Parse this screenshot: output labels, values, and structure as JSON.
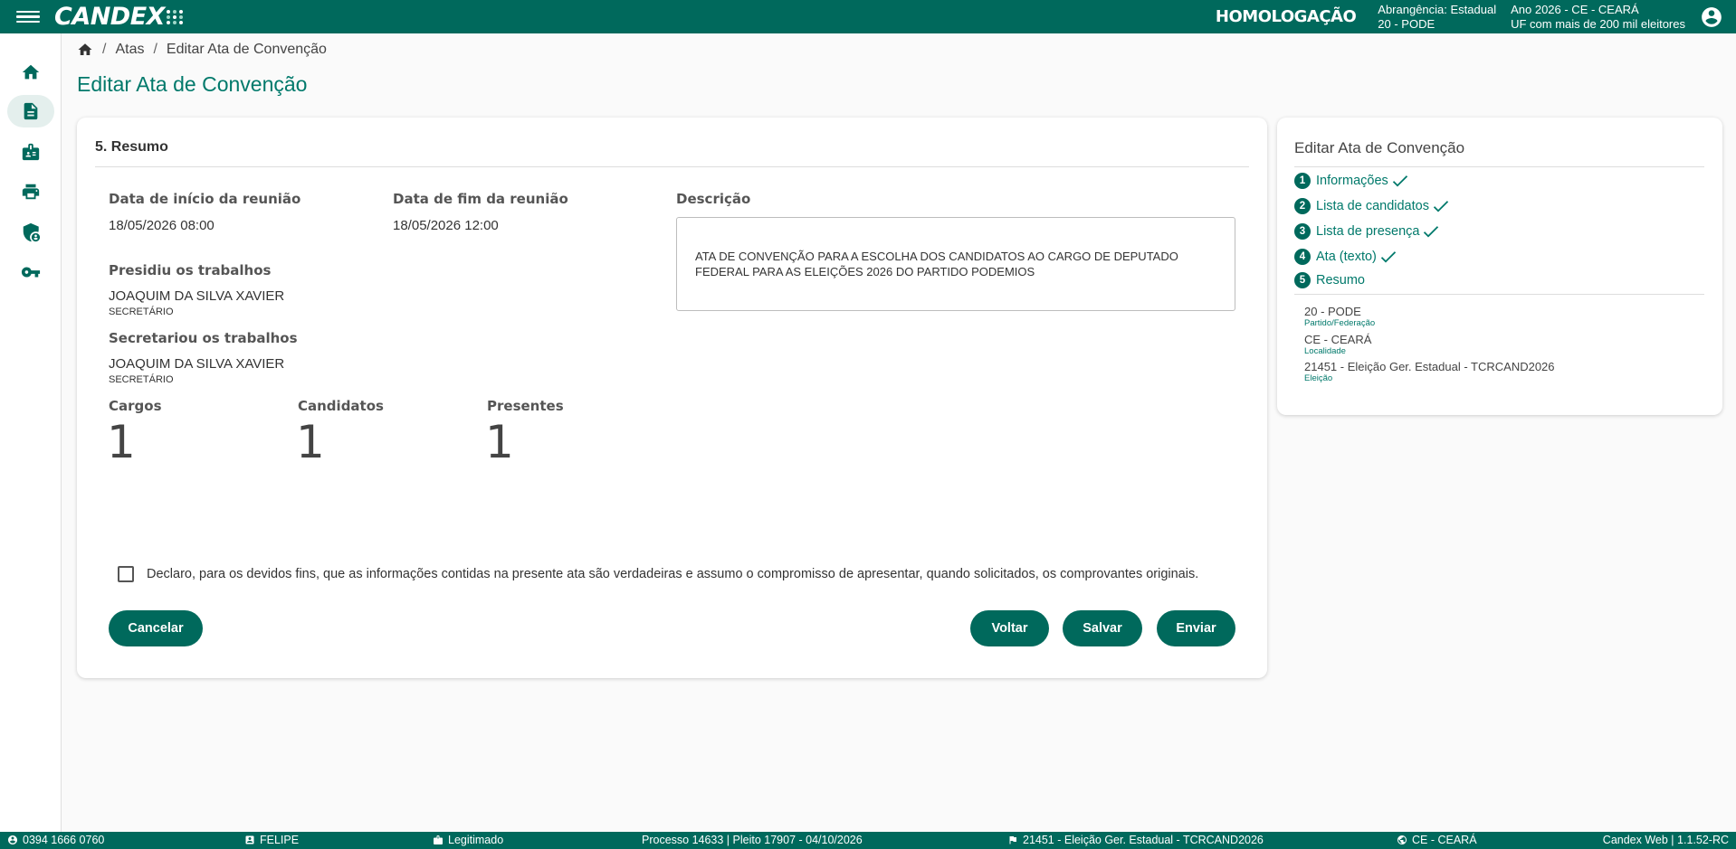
{
  "app": {
    "logo_text": "CANDEX",
    "environment": "HOMOLOGAÇÃO",
    "context": {
      "abrangencia": "Abrangência: Estadual",
      "partido": "20 - PODE",
      "ano": "Ano 2026 - CE - CEARÁ",
      "uf_info": "UF com mais de 200 mil eleitores"
    }
  },
  "nav": {
    "items": [
      {
        "name": "home",
        "icon": "home-icon"
      },
      {
        "name": "atas",
        "icon": "document-icon",
        "active": true
      },
      {
        "name": "candidatos",
        "icon": "badge-icon"
      },
      {
        "name": "imprimir",
        "icon": "print-icon"
      },
      {
        "name": "seguranca",
        "icon": "security-user-icon"
      },
      {
        "name": "chave",
        "icon": "key-icon"
      }
    ]
  },
  "breadcrumb": {
    "home_icon": "home-icon",
    "atas": "Atas",
    "current": "Editar Ata de Convenção"
  },
  "page": {
    "title": "Editar Ata de Convenção"
  },
  "resumo": {
    "section_title": "5. Resumo",
    "data_inicio_label": "Data de início da reunião",
    "data_inicio_value": "18/05/2026 08:00",
    "data_fim_label": "Data de fim da reunião",
    "data_fim_value": "18/05/2026 12:00",
    "descricao_label": "Descrição",
    "descricao_value": "ATA DE CONVENÇÃO PARA A ESCOLHA DOS CANDIDATOS AO CARGO DE DEPUTADO FEDERAL PARA AS ELEIÇÕES 2026 DO PARTIDO PODEMIOS",
    "presidiu_label": "Presidiu os trabalhos",
    "presidiu_nome": "JOAQUIM DA SILVA XAVIER",
    "presidiu_cargo": "SECRETÁRIO",
    "secretariou_label": "Secretariou os trabalhos",
    "secretariou_nome": "JOAQUIM DA SILVA XAVIER",
    "secretariou_cargo": "SECRETÁRIO",
    "cargos_label": "Cargos",
    "cargos_value": "1",
    "candidatos_label": "Candidatos",
    "candidatos_value": "1",
    "presentes_label": "Presentes",
    "presentes_value": "1",
    "declaracao": "Declaro, para os devidos fins, que as informações contidas na presente ata são verdadeiras e assumo o compromisso de apresentar, quando solicitados, os comprovantes originais.",
    "declaracao_checked": false
  },
  "actions": {
    "cancelar": "Cancelar",
    "voltar": "Voltar",
    "salvar": "Salvar",
    "enviar": "Enviar"
  },
  "sidebar": {
    "title": "Editar Ata de Convenção",
    "steps": [
      {
        "num": "1",
        "label": "Informações",
        "done": true
      },
      {
        "num": "2",
        "label": "Lista de candidatos",
        "done": true
      },
      {
        "num": "3",
        "label": "Lista de presença",
        "done": true
      },
      {
        "num": "4",
        "label": "Ata (texto)",
        "done": true
      },
      {
        "num": "5",
        "label": "Resumo",
        "done": false
      }
    ],
    "info": [
      {
        "value": "20 - PODE",
        "label": "Partido/Federação"
      },
      {
        "value": "CE - CEARÁ",
        "label": "Localidade"
      },
      {
        "value": "21451 - Eleição Ger. Estadual - TCRCAND2026",
        "label": "Eleição"
      }
    ]
  },
  "statusbar": {
    "user_code": "0394 1666 0760",
    "user_name": "FELIPE",
    "papel": "Legitimado",
    "processo": "Processo 14633 | Pleito 17907 - 04/10/2026",
    "eleicao": "21451 - Eleição Ger. Estadual - TCRCAND2026",
    "local": "CE - CEARÁ",
    "versao": "Candex Web | 1.1.52-RC"
  },
  "colors": {
    "primary": "#00695c",
    "accent_text": "#00796b"
  }
}
